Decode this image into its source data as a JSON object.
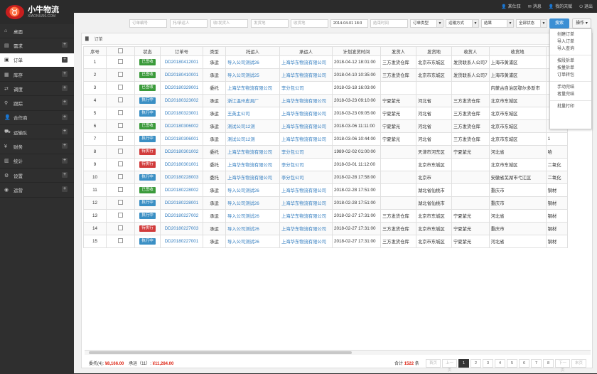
{
  "brand": {
    "title": "小牛物流",
    "subtitle": "XIAONIU56.COM",
    "logo_glyph": "♉"
  },
  "toplinks": [
    {
      "icon": "user-icon",
      "glyph": "👤",
      "label": "某仕驭"
    },
    {
      "icon": "message-icon",
      "glyph": "✉",
      "label": "消息"
    },
    {
      "icon": "user-icon",
      "glyph": "👤",
      "label": "我的天赋"
    },
    {
      "icon": "power-icon",
      "glyph": "⏻",
      "label": "退出"
    }
  ],
  "sidebar": {
    "items": [
      {
        "key": "desktop",
        "icon": "home-icon",
        "glyph": "⌂",
        "label": "桌面",
        "plus": false,
        "active": false
      },
      {
        "key": "demand",
        "icon": "demand-icon",
        "glyph": "▤",
        "label": "需求",
        "plus": true,
        "active": false
      },
      {
        "key": "order",
        "icon": "order-icon",
        "glyph": "▣",
        "label": "订单",
        "plus": true,
        "active": true
      },
      {
        "key": "inventory",
        "icon": "inventory-icon",
        "glyph": "▦",
        "label": "库存",
        "plus": true,
        "active": false
      },
      {
        "key": "dispatch",
        "icon": "shuffle-icon",
        "glyph": "⇄",
        "label": "调度",
        "plus": true,
        "active": false
      },
      {
        "key": "track",
        "icon": "location-icon",
        "glyph": "⚲",
        "label": "跟踪",
        "plus": true,
        "active": false
      },
      {
        "key": "partner",
        "icon": "partner-icon",
        "glyph": "👤",
        "label": "合作商",
        "plus": true,
        "active": false
      },
      {
        "key": "fleet",
        "icon": "truck-icon",
        "glyph": "⛟",
        "label": "运输队",
        "plus": true,
        "active": false
      },
      {
        "key": "finance",
        "icon": "finance-icon",
        "glyph": "¥",
        "label": "财务",
        "plus": true,
        "active": false
      },
      {
        "key": "stats",
        "icon": "chart-icon",
        "glyph": "▥",
        "label": "统计",
        "plus": true,
        "active": false
      },
      {
        "key": "settings",
        "icon": "gear-icon",
        "glyph": "⚙",
        "label": "设置",
        "plus": true,
        "active": false
      },
      {
        "key": "operation",
        "icon": "operation-icon",
        "glyph": "◉",
        "label": "运营",
        "plus": true,
        "active": false
      }
    ]
  },
  "filters": {
    "order_no": "订单编号",
    "consignor": "托/承运人",
    "consignee": "收/发货人",
    "origin": "发货地",
    "destination": "收货地",
    "start_time": "2014-04-01 18:3",
    "end_time": "结束时间",
    "order_type": "订单类型",
    "transport_mode": "运输方式",
    "result": "结果",
    "status": "全部状态",
    "search": "搜索",
    "operation": "操作"
  },
  "breadcrumb": "订单",
  "table": {
    "headers": [
      "序号",
      "",
      "状态",
      "订单号",
      "类型",
      "托运人",
      "承运人",
      "计划发货时间",
      "发货人",
      "发货地",
      "收货人",
      "收货地",
      "备注"
    ],
    "rows": [
      {
        "no": "1",
        "status": "已签收",
        "order": "DD20180412001",
        "type": "承运",
        "consignor": "导入公司测试26",
        "carrier": "上海华东物流有限公司",
        "time": "2018-04-12 18:01:00",
        "shipper": "三方发货仓库",
        "from": "北京市东城区",
        "receiver": "发货联系人公司7",
        "to": "上海市黄浦区",
        "remark": ""
      },
      {
        "no": "2",
        "status": "已签收",
        "order": "DD20180410001",
        "type": "承运",
        "consignor": "导入公司测试25",
        "carrier": "上海华东物流有限公司",
        "time": "2018-04-10 10:35:00",
        "shipper": "三方发货仓库",
        "from": "北京市东城区",
        "receiver": "发货联系人公司7",
        "to": "上海市黄浦区",
        "remark": ""
      },
      {
        "no": "3",
        "status": "已签收",
        "order": "DD20180329001",
        "type": "委托",
        "consignor": "上海华东物流有限公司",
        "carrier": "李分包公司",
        "time": "2018-03-18 16:03:00",
        "shipper": "",
        "from": "",
        "receiver": "",
        "to": "内蒙古自治区鄂尔多斯市",
        "remark": ""
      },
      {
        "no": "4",
        "status": "执行中",
        "order": "DD20180323002",
        "type": "承运",
        "consignor": "浙江温州皮具厂",
        "carrier": "上海华东物流有限公司",
        "time": "2018-03-23 09:10:00",
        "shipper": "宁夏紫光",
        "from": "河北省",
        "receiver": "三方发货仓库",
        "to": "北京市东城区",
        "remark": ""
      },
      {
        "no": "5",
        "status": "执行中",
        "order": "DD20180323001",
        "type": "承运",
        "consignor": "王英主公司",
        "carrier": "上海华东物流有限公司",
        "time": "2018-03-23 09:05:00",
        "shipper": "宁夏紫光",
        "from": "河北省",
        "receiver": "三方发货仓库",
        "to": "北京市东城区",
        "remark": ""
      },
      {
        "no": "6",
        "status": "已签收",
        "order": "DD20180306002",
        "type": "承运",
        "consignor": "测试公司12测",
        "carrier": "上海华东物流有限公司",
        "time": "2018-03-06 11:11:00",
        "shipper": "宁夏紫光",
        "from": "河北省",
        "receiver": "三方发货仓库",
        "to": "北京市东城区",
        "remark": ""
      },
      {
        "no": "7",
        "status": "执行中",
        "order": "DD20180306001",
        "type": "承运",
        "consignor": "测试公司12测",
        "carrier": "上海华东物流有限公司",
        "time": "2018-03-06 10:44:00",
        "shipper": "宁夏紫光",
        "from": "河北省",
        "receiver": "三方发货仓库",
        "to": "北京市东城区",
        "remark": "1"
      },
      {
        "no": "8",
        "status": "待执行",
        "order": "DD20180301002",
        "type": "委托",
        "consignor": "上海华东物流有限公司",
        "carrier": "李分包公司",
        "time": "1989-02-02 01:00:00",
        "shipper": "",
        "from": "天津市河东区",
        "receiver": "宁夏紫光",
        "to": "河北省",
        "remark": "哈"
      },
      {
        "no": "9",
        "status": "待执行",
        "order": "DD20180301001",
        "type": "委托",
        "consignor": "上海华东物流有限公司",
        "carrier": "李分包公司",
        "time": "2018-03-01 11:12:00",
        "shipper": "",
        "from": "北京市东城区",
        "receiver": "",
        "to": "北京市东城区",
        "remark": "二氧化"
      },
      {
        "no": "10",
        "status": "执行中",
        "order": "DD20180228003",
        "type": "委托",
        "consignor": "上海华东物流有限公司",
        "carrier": "李分包公司",
        "time": "2018-02-28 17:58:00",
        "shipper": "",
        "from": "北京市",
        "receiver": "",
        "to": "安徽省芜湖市弋江区",
        "remark": "二氧化"
      },
      {
        "no": "11",
        "status": "已签收",
        "order": "DD20180228002",
        "type": "承运",
        "consignor": "导入公司测试26",
        "carrier": "上海华东物流有限公司",
        "time": "2018-02-28 17:51:00",
        "shipper": "",
        "from": "湖北省仙桃市",
        "receiver": "",
        "to": "重庆市",
        "remark": "钢材"
      },
      {
        "no": "12",
        "status": "执行中",
        "order": "DD20180228001",
        "type": "承运",
        "consignor": "导入公司测试26",
        "carrier": "上海华东物流有限公司",
        "time": "2018-02-28 17:51:00",
        "shipper": "",
        "from": "湖北省仙桃市",
        "receiver": "",
        "to": "重庆市",
        "remark": "钢材"
      },
      {
        "no": "13",
        "status": "执行中",
        "order": "DD20180227002",
        "type": "承运",
        "consignor": "导入公司测试26",
        "carrier": "上海华东物流有限公司",
        "time": "2018-02-27 17:31:00",
        "shipper": "三方发货仓库",
        "from": "北京市东城区",
        "receiver": "宁夏紫光",
        "to": "河北省",
        "remark": "钢材"
      },
      {
        "no": "14",
        "status": "待执行",
        "order": "DD20180227003",
        "type": "承运",
        "consignor": "导入公司测试26",
        "carrier": "上海华东物流有限公司",
        "time": "2018-02-27 17:31:00",
        "shipper": "三方发货仓库",
        "from": "北京市东城区",
        "receiver": "宁夏紫光",
        "to": "重庆市",
        "remark": "钢材"
      },
      {
        "no": "15",
        "status": "执行中",
        "order": "DD20180227001",
        "type": "承运",
        "consignor": "导入公司测试26",
        "carrier": "上海华东物流有限公司",
        "time": "2018-02-27 17:31:00",
        "shipper": "三方发货仓库",
        "from": "北京市东城区",
        "receiver": "宁夏紫光",
        "to": "河北省",
        "remark": "钢材"
      }
    ]
  },
  "status_colors": {
    "已签收": "#3a9a3a",
    "执行中": "#3a8fc4",
    "待执行": "#d13b3b"
  },
  "summary": {
    "entrust_label": "委托(4):",
    "entrust_amount": "¥8,166.00",
    "carry_label": "承运（11）:",
    "carry_amount": "¥11,284.00"
  },
  "pagination": {
    "total_prefix": "合计",
    "total_count": "1522",
    "total_suffix": "条",
    "first": "首页",
    "prev": "上一页",
    "pages": [
      "1",
      "2",
      "3",
      "4",
      "5",
      "6",
      "7",
      "8"
    ],
    "current": "1",
    "next": "下一页",
    "last": "末页"
  },
  "dropdown": {
    "groups": [
      [
        "创建订单",
        "导入订单",
        "导入查询"
      ],
      [
        "按段拆单",
        "按量拆单",
        "订单转包"
      ],
      [
        "手动完结",
        "者量完结"
      ],
      [
        "批量打印"
      ]
    ]
  }
}
